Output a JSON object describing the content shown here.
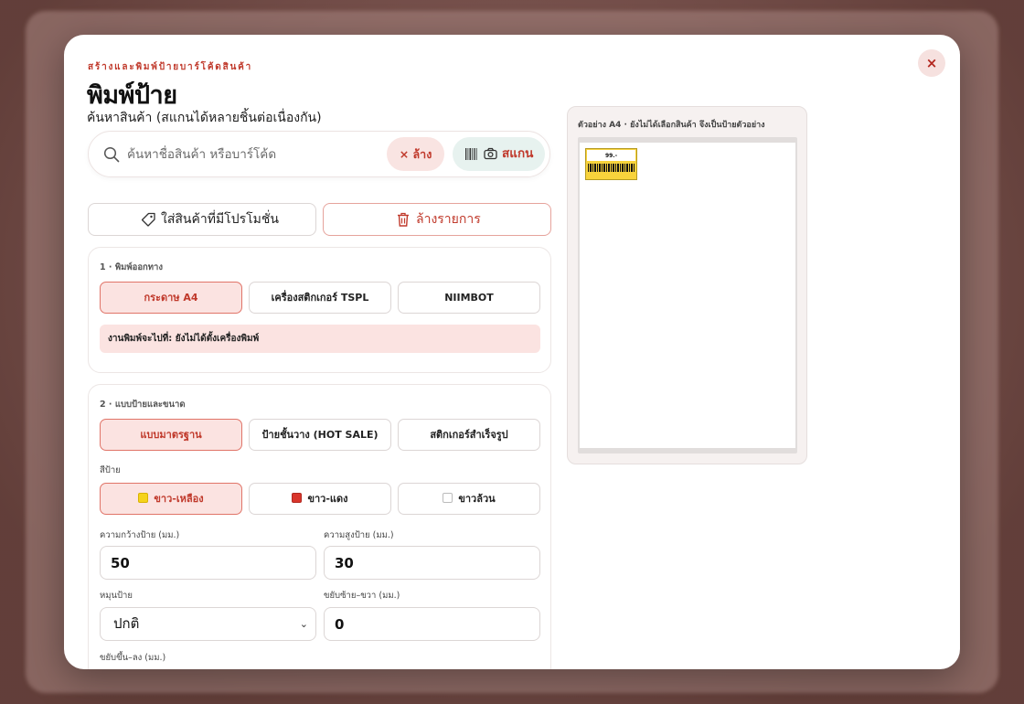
{
  "modal": {
    "eyebrow": "สร้างและพิมพ์ป้ายบาร์โค้ดสินค้า",
    "title": "พิมพ์ป้าย",
    "subtitle": "ค้นหาสินค้า (สแกนได้หลายชิ้นต่อเนื่องกัน)",
    "close_label": "×"
  },
  "search": {
    "placeholder": "ค้นหาชื่อสินค้า หรือบาร์โค้ด",
    "value": "",
    "clear_label": "× ล้าง",
    "scan_label": "สแกน"
  },
  "actions": {
    "promo_label": "ใส่สินค้าที่มีโปรโมชั่น",
    "clear_list_label": "ล้างรายการ"
  },
  "print_output": {
    "title": "1 · พิมพ์ออกทาง",
    "options": [
      {
        "label": "กระดาษ A4",
        "active": true
      },
      {
        "label": "เครื่องสติกเกอร์ TSPL",
        "active": false
      },
      {
        "label": "NIIMBOT",
        "active": false
      }
    ],
    "notice": "งานพิมพ์จะไปที่: ยังไม่ได้ตั้งเครื่องพิมพ์"
  },
  "label_style": {
    "title": "2 · แบบป้ายและขนาด",
    "types": [
      {
        "label": "แบบมาตรฐาน",
        "active": true
      },
      {
        "label": "ป้ายชั้นวาง (HOT SALE)",
        "active": false
      },
      {
        "label": "สติกเกอร์สำเร็จรูป",
        "active": false
      }
    ],
    "color_label": "สีป้าย",
    "colors": [
      {
        "label": "ขาว-เหลือง",
        "swatch": "#f5d31c",
        "active": true
      },
      {
        "label": "ขาว-แดง",
        "swatch": "#d9352b",
        "active": false
      },
      {
        "label": "ขาวล้วน",
        "swatch": "#ffffff",
        "active": false
      }
    ],
    "width_label": "ความกว้างป้าย (มม.)",
    "width_value": "50",
    "height_label": "ความสูงป้าย (มม.)",
    "height_value": "30",
    "rotate_label": "หมุนป้าย",
    "rotate_value": "ปกติ",
    "shift_x_label": "ขยับซ้าย–ขวา (มม.)",
    "shift_x_value": "0",
    "shift_y_label": "ขยับขึ้น–ลง (มม.)"
  },
  "preview": {
    "caption": "ตัวอย่าง A4 · ยังไม่ได้เลือกสินค้า จึงเป็นป้ายตัวอย่าง",
    "sample_price": "99.-"
  },
  "colors": {
    "accent": "#c0392b",
    "accent_soft": "#fbe3e1",
    "scan_bg": "#e7f2ef"
  }
}
